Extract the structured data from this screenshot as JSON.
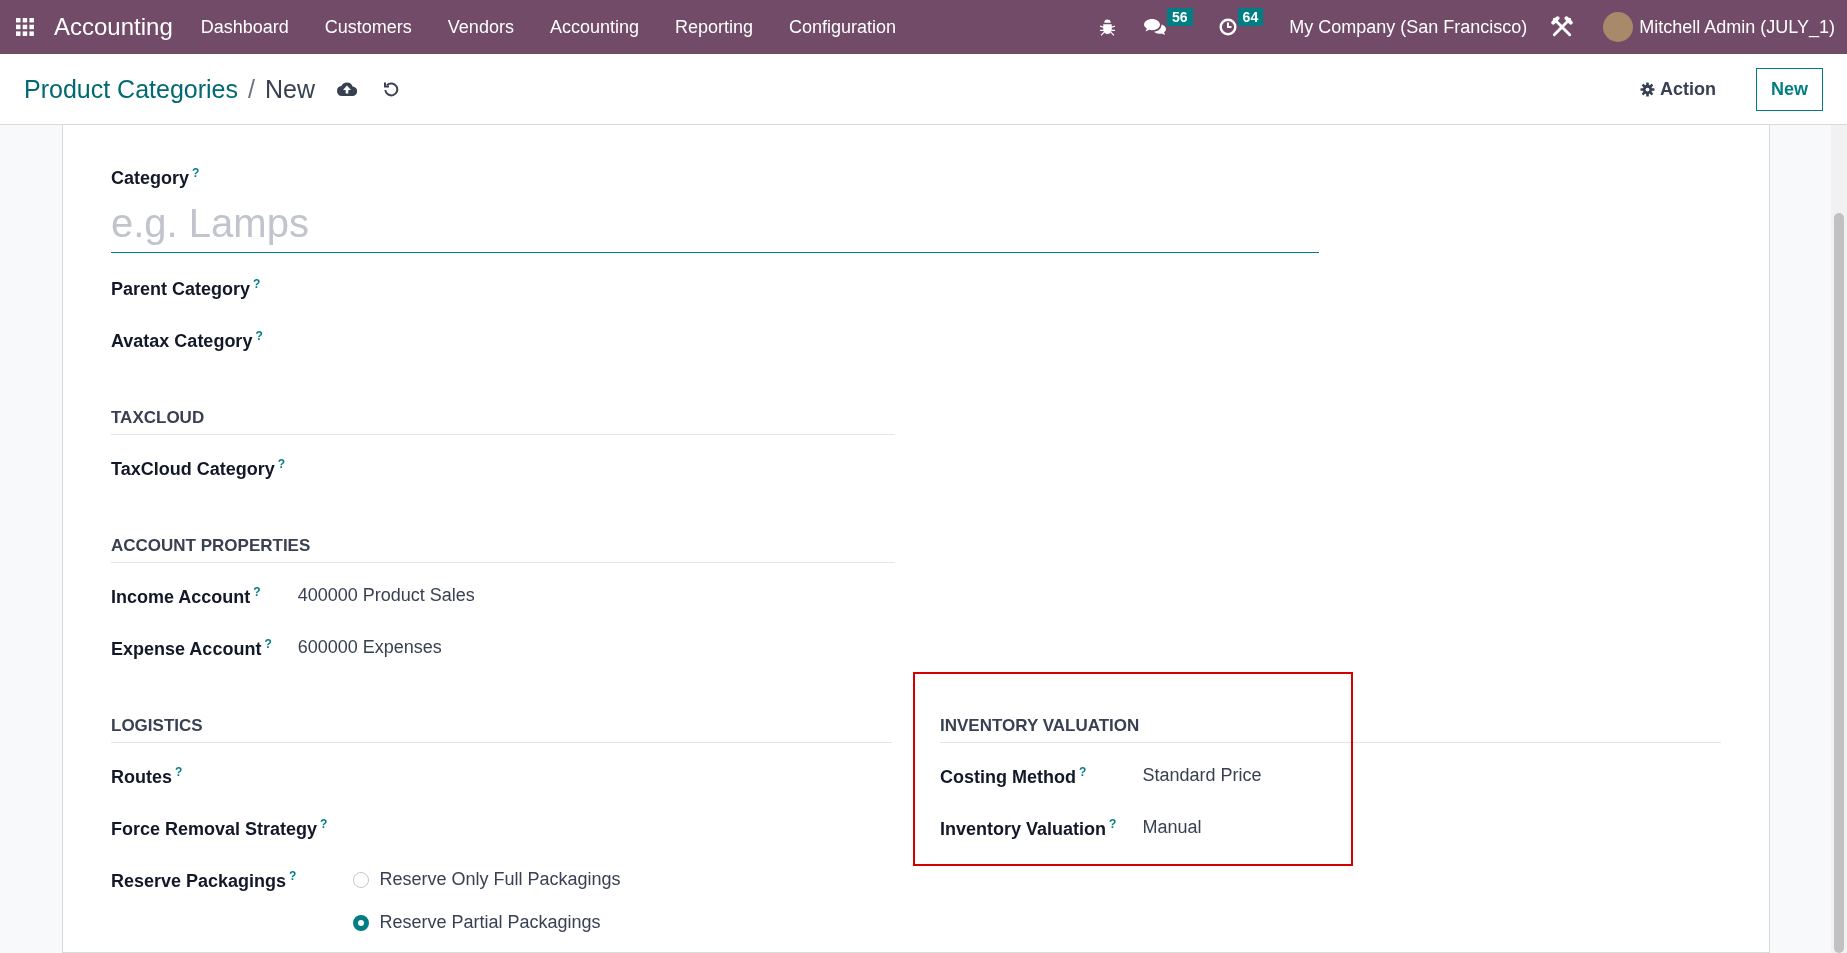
{
  "navbar": {
    "app_name": "Accounting",
    "menu": [
      "Dashboard",
      "Customers",
      "Vendors",
      "Accounting",
      "Reporting",
      "Configuration"
    ],
    "messages_badge": "56",
    "activities_badge": "64",
    "company": "My Company (San Francisco)",
    "user": "Mitchell Admin (JULY_1)"
  },
  "control_panel": {
    "breadcrumb_parent": "Product Categories",
    "breadcrumb_separator": "/",
    "breadcrumb_current": "New",
    "action_button": "Action",
    "new_button": "New"
  },
  "form": {
    "title_field": {
      "label": "Category",
      "help": "?",
      "placeholder": "e.g. Lamps"
    },
    "top_fields": [
      {
        "label": "Parent Category",
        "help": "?"
      },
      {
        "label": "Avatax Category",
        "help": "?"
      }
    ],
    "rows": [
      {
        "groups": [
          {
            "title": "TAXCLOUD",
            "highlighted": false,
            "fields": [
              {
                "kind": "text",
                "label": "TaxCloud Category",
                "help": "?"
              }
            ]
          }
        ]
      },
      {
        "groups": [
          {
            "title": "ACCOUNT PROPERTIES",
            "highlighted": false,
            "fields": [
              {
                "kind": "text",
                "label": "Income Account",
                "help": "?",
                "value": "400000 Product Sales"
              },
              {
                "kind": "text",
                "label": "Expense Account",
                "help": "?",
                "value": "600000 Expenses"
              }
            ]
          }
        ]
      },
      {
        "groups": [
          {
            "title": "LOGISTICS",
            "highlighted": false,
            "fields": [
              {
                "kind": "text",
                "label": "Routes",
                "help": "?"
              },
              {
                "kind": "text",
                "label": "Force Removal Strategy",
                "help": "?"
              },
              {
                "kind": "radio",
                "label": "Reserve Packagings",
                "help": "?",
                "options": [
                  {
                    "label": "Reserve Only Full Packagings",
                    "selected": false
                  },
                  {
                    "label": "Reserve Partial Packagings",
                    "selected": true
                  }
                ]
              }
            ]
          },
          {
            "title": "INVENTORY VALUATION",
            "highlighted": true,
            "fields": [
              {
                "kind": "text",
                "label": "Costing Method",
                "help": "?",
                "value": "Standard Price"
              },
              {
                "kind": "text",
                "label": "Inventory Valuation",
                "help": "?",
                "value": "Manual"
              }
            ]
          }
        ]
      }
    ]
  }
}
